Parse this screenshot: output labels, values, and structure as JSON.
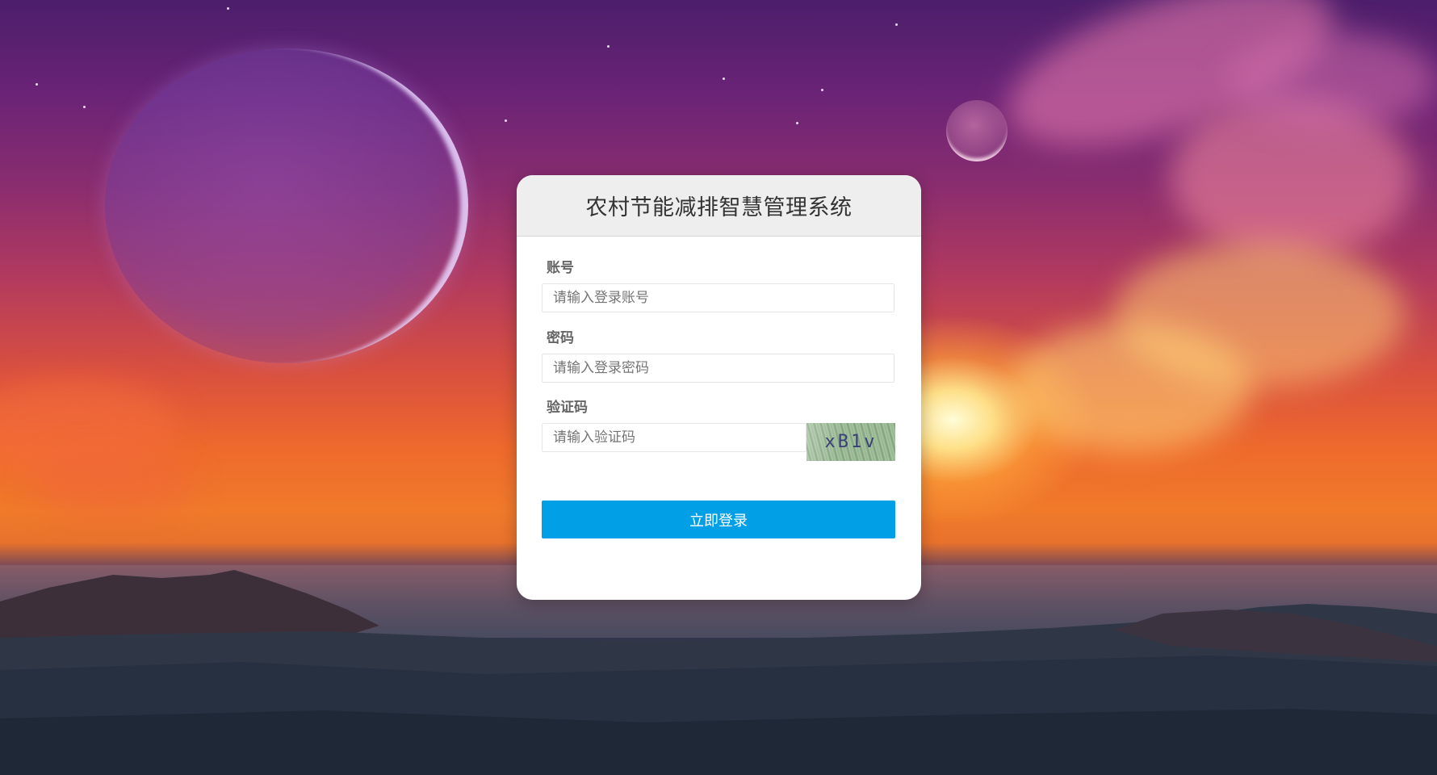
{
  "login": {
    "title": "农村节能减排智慧管理系统",
    "account": {
      "label": "账号",
      "placeholder": "请输入登录账号",
      "value": ""
    },
    "password": {
      "label": "密码",
      "placeholder": "请输入登录密码",
      "value": ""
    },
    "captcha": {
      "label": "验证码",
      "placeholder": "请输入验证码",
      "value": "",
      "image_text": "xB1v"
    },
    "submit_label": "立即登录"
  },
  "colors": {
    "button_primary": "#009fe6",
    "header_bg": "#eeeeee",
    "card_bg": "#ffffff",
    "title_text": "#333333",
    "label_text": "#666666"
  }
}
